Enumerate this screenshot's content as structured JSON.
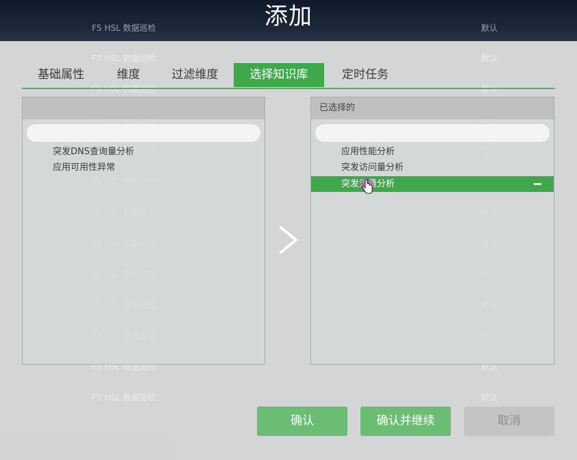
{
  "header": {
    "title": "添加"
  },
  "background_rows": [
    {
      "name": "F5 HSL 数据巡检",
      "value": "默认"
    },
    {
      "name": "F5 HSL 数据巡检",
      "value": "默认"
    },
    {
      "name": "F5 HSL 数据巡检",
      "value": "默认"
    },
    {
      "name": "F5 HSL 数据巡检",
      "value": "默认"
    },
    {
      "name": "F5 HSL 数据巡检",
      "value": "默认"
    },
    {
      "name": "F5 HSL 数据巡检",
      "value": "默认"
    },
    {
      "name": "F5 HSL 数据巡检",
      "value": "默认"
    },
    {
      "name": "F5 HSL 数据巡检",
      "value": "默认"
    },
    {
      "name": "F5 HSL 数据巡检",
      "value": "默认"
    },
    {
      "name": "F5 HSL 数据巡检",
      "value": "默认"
    },
    {
      "name": "F5 HSL 数据巡检",
      "value": "默认"
    },
    {
      "name": "F5 HSL 数据巡检",
      "value": "默认"
    },
    {
      "name": "F5 HSL 数据巡检",
      "value": "默认"
    }
  ],
  "tabs": [
    {
      "label": "基础属性"
    },
    {
      "label": "维度"
    },
    {
      "label": "过滤维度"
    },
    {
      "label": "选择知识库",
      "active": true
    },
    {
      "label": "定时任务"
    }
  ],
  "left_panel": {
    "header": "",
    "search_placeholder": "",
    "items": [
      "突发DNS查询量分析",
      "应用可用性异常"
    ]
  },
  "right_panel": {
    "header": "已选择的",
    "search_placeholder": "",
    "items": [
      "应用性能分析",
      "突发访问量分析",
      "突发流量分析"
    ],
    "selected_index": 2
  },
  "buttons": {
    "confirm": "确认",
    "confirm_continue": "确认并继续",
    "cancel": "取消"
  },
  "colors": {
    "accent": "#3fa84a",
    "button_green": "#6bbd74",
    "header_dark": "#0e1a2b"
  },
  "icons": {
    "transfer": "chevron-right-icon",
    "remove": "minus-icon",
    "cursor": "hand-pointer-icon"
  }
}
